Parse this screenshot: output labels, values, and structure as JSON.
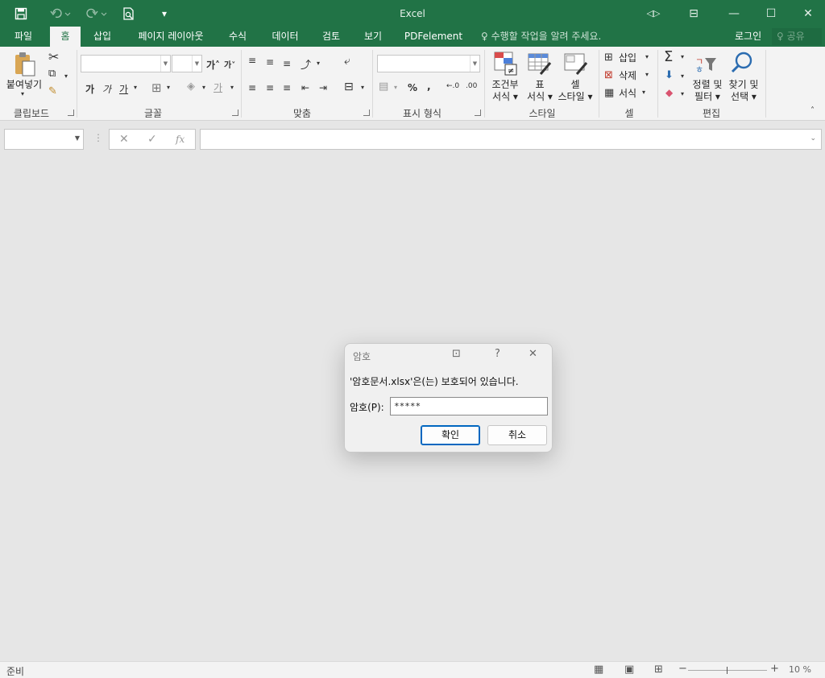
{
  "window": {
    "title": "Excel",
    "qa_save_icon": "save-icon",
    "qa_undo_icon": "undo-icon",
    "qa_redo_icon": "redo-icon",
    "qa_preview_icon": "print-preview-icon",
    "customize_glyph": "▾",
    "display_options_glyph": "⊟",
    "minimize_glyph": "—",
    "maximize_glyph": "☐",
    "close_glyph": "✕",
    "accent": "#217346"
  },
  "tabs": [
    {
      "label": "파일"
    },
    {
      "label": "홈"
    },
    {
      "label": "삽입"
    },
    {
      "label": "페이지 레이아웃"
    },
    {
      "label": "수식"
    },
    {
      "label": "데이터"
    },
    {
      "label": "검토"
    },
    {
      "label": "보기"
    },
    {
      "label": "PDFelement"
    }
  ],
  "tellme": "♀ 수행할 작업을 알려 주세요.",
  "login": "로그인",
  "share": "♀ 공유",
  "ribbon": {
    "clipboard": {
      "paste_label": "붙여넣기",
      "group_label": "클립보드"
    },
    "font": {
      "bold": "가",
      "italic": "가",
      "underline": "가",
      "grow": "가˄",
      "shrink": "가˅",
      "group_label": "글꼴"
    },
    "alignment": {
      "group_label": "맞춤"
    },
    "number": {
      "percent": "%",
      "comma": ",",
      "inc_dec": "←.0",
      "dec_dec": ".00",
      "group_label": "표시 형식"
    },
    "styles": {
      "conditional_line1": "조건부",
      "conditional_line2": "서식 ▾",
      "table_line1": "표",
      "table_line2": "서식 ▾",
      "cell_line1": "셀",
      "cell_line2": "스타일 ▾",
      "group_label": "스타일"
    },
    "cells": {
      "insert": "삽입",
      "delete": "삭제",
      "format": "서식",
      "group_label": "셀"
    },
    "editing": {
      "sigma": "Σ",
      "sort_line1": "정렬 및",
      "sort_line2": "필터 ▾",
      "find_line1": "찾기 및",
      "find_line2": "선택 ▾",
      "group_label": "편집"
    }
  },
  "formula_bar": {
    "cancel": "✕",
    "enter": "✓",
    "fx": "fx"
  },
  "dialog": {
    "title": "암호",
    "restore_glyph": "⊡",
    "help_glyph": "?",
    "close_glyph": "✕",
    "message": "'암호문서.xlsx'은(는) 보호되어 있습니다.",
    "label": "암호(P):",
    "value": "*****",
    "ok": "확인",
    "cancel": "취소"
  },
  "status": {
    "text": "준비",
    "normal_view_glyph": "▦",
    "page_layout_glyph": "▣",
    "page_break_glyph": "⊞",
    "zoom_minus": "−",
    "zoom_plus": "+",
    "zoom": "10 %"
  }
}
